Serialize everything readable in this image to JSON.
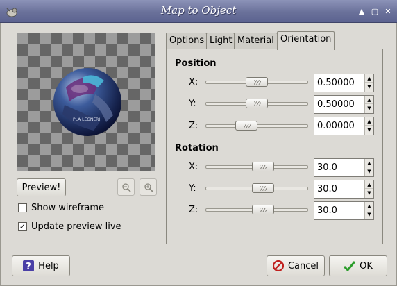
{
  "window": {
    "title": "Map to Object"
  },
  "preview": {
    "button_label": "Preview!",
    "zoom_out_icon": "zoom-out-icon",
    "zoom_in_icon": "zoom-in-icon"
  },
  "options": {
    "show_wireframe": {
      "label": "Show wireframe",
      "checked": false
    },
    "update_preview_live": {
      "label": "Update preview live",
      "checked": true
    }
  },
  "tabs": [
    {
      "label": "Options",
      "active": false
    },
    {
      "label": "Light",
      "active": false
    },
    {
      "label": "Material",
      "active": false
    },
    {
      "label": "Orientation",
      "active": true
    }
  ],
  "position": {
    "heading": "Position",
    "x": {
      "label": "X:",
      "value": "0.50000",
      "fraction": 0.5
    },
    "y": {
      "label": "Y:",
      "value": "0.50000",
      "fraction": 0.5
    },
    "z": {
      "label": "Z:",
      "value": "0.00000",
      "fraction": 0.37
    }
  },
  "rotation": {
    "heading": "Rotation",
    "x": {
      "label": "X:",
      "value": "30.0",
      "fraction": 0.58
    },
    "y": {
      "label": "Y:",
      "value": "30.0",
      "fraction": 0.58
    },
    "z": {
      "label": "Z:",
      "value": "30.0",
      "fraction": 0.58
    }
  },
  "buttons": {
    "help": "Help",
    "cancel": "Cancel",
    "ok": "OK"
  },
  "colors": {
    "titlebar": "#6a719a",
    "ok_check": "#2a9c2a",
    "cancel_icon": "#c0201e",
    "help_icon": "#4a3fa6"
  }
}
